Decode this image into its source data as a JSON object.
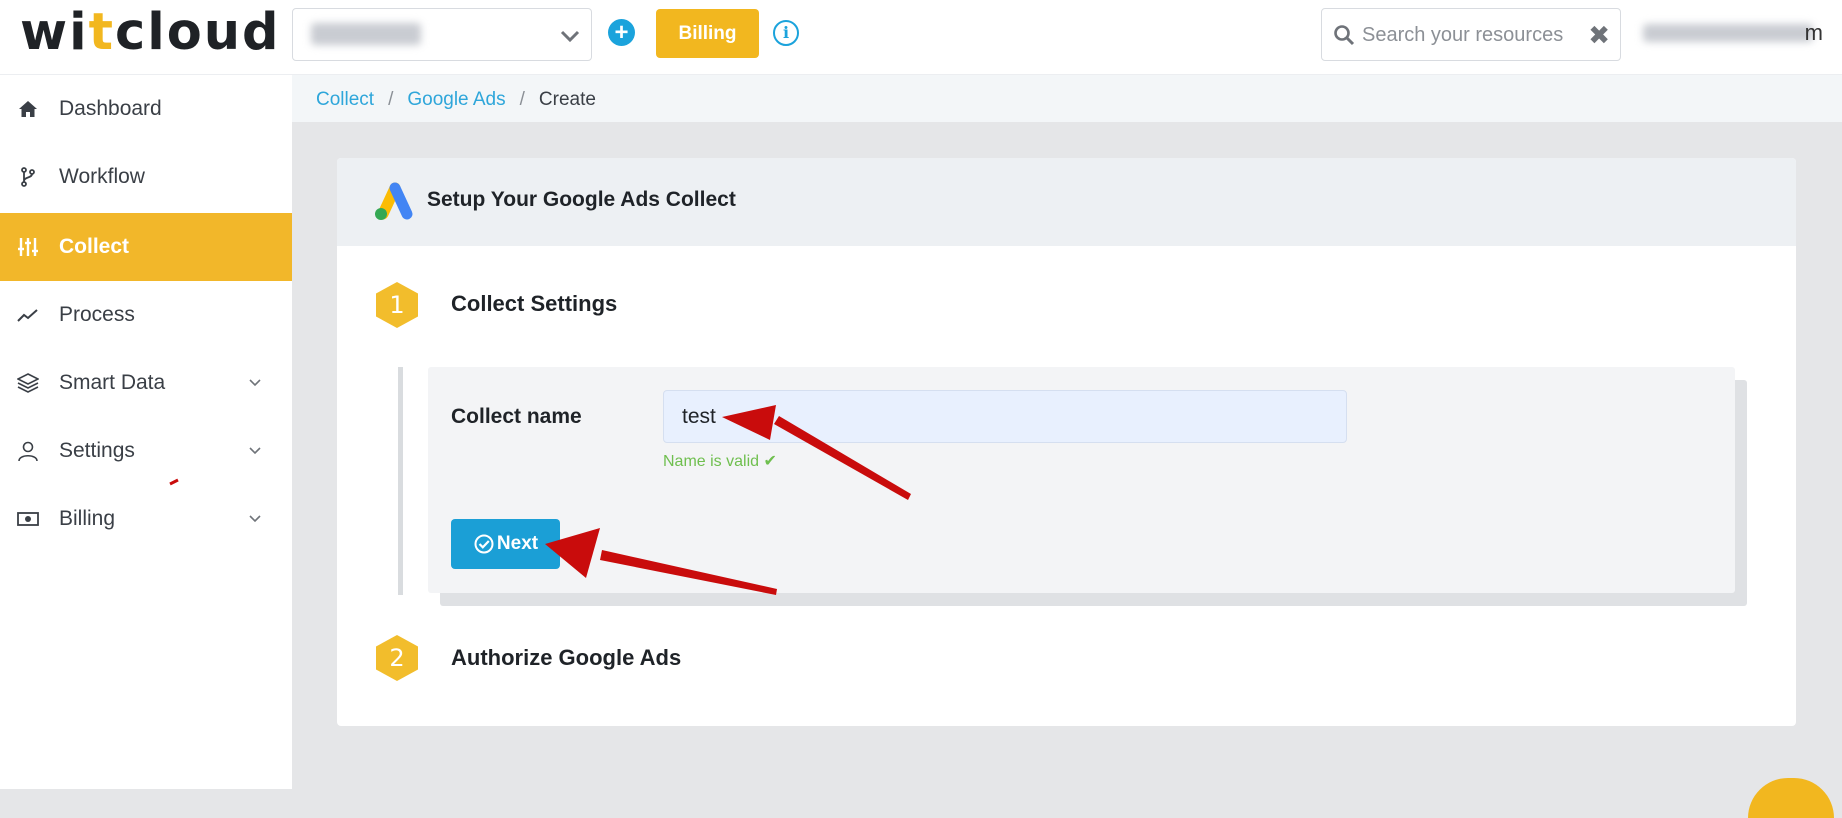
{
  "topbar": {
    "logo_left": "wi",
    "logo_accent": "t",
    "logo_right": "cloud",
    "billing_label": "Billing",
    "info_glyph": "i",
    "search_placeholder": "Search your resources",
    "clear_glyph": "✖",
    "user_tail": "m"
  },
  "sidebar": {
    "items": [
      {
        "label": "Dashboard",
        "icon": "home-icon"
      },
      {
        "label": "Workflow",
        "icon": "branch-icon"
      },
      {
        "label": "Collect",
        "icon": "sliders-icon",
        "active": true
      },
      {
        "label": "Process",
        "icon": "chart-line-icon"
      },
      {
        "label": "Smart Data",
        "icon": "layers-icon",
        "expandable": true
      },
      {
        "label": "Settings",
        "icon": "user-icon",
        "expandable": true
      },
      {
        "label": "Billing",
        "icon": "money-icon",
        "expandable": true
      }
    ]
  },
  "breadcrumb": {
    "items": [
      "Collect",
      "Google Ads",
      "Create"
    ],
    "separator": "/"
  },
  "card": {
    "title": "Setup Your Google Ads Collect",
    "step1": {
      "number": "1",
      "title": "Collect Settings"
    },
    "step2": {
      "number": "2",
      "title": "Authorize Google Ads"
    },
    "form": {
      "label": "Collect name",
      "value": "test",
      "valid_message": "Name is valid ✔",
      "next_label": "Next"
    }
  },
  "colors": {
    "accent": "#f2b71f",
    "primary": "#1b9fd6",
    "success": "#6fbf4f",
    "annotation": "#c90c0c"
  }
}
